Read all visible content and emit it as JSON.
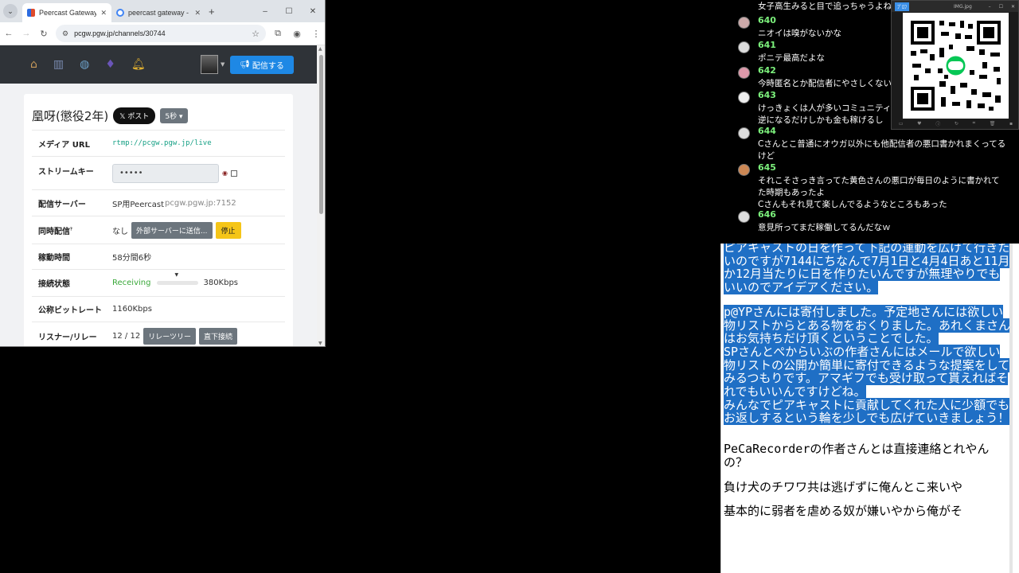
{
  "browser": {
    "tabs": [
      {
        "title": "Peercast Gateway /",
        "active": true
      },
      {
        "title": "peercast gateway -",
        "active": false
      }
    ],
    "new_tab": "+",
    "window_controls": [
      "–",
      "☐",
      "✕"
    ],
    "url": "pcgw.pgw.jp/channels/30744"
  },
  "site": {
    "nav_icons": [
      "home-icon",
      "chart-icon",
      "globe-icon",
      "fire-icon",
      "bell-icon"
    ],
    "broadcast_button": "配信する"
  },
  "channel": {
    "title": "凰呀(懲役2年)",
    "post_button": "ポスト",
    "interval_select": "5秒",
    "rows": {
      "media_url": {
        "label": "メディア URL",
        "value": "rtmp://pcgw.pgw.jp/live"
      },
      "stream_key": {
        "label": "ストリームキー",
        "value": "•••••"
      },
      "server": {
        "label": "配信サーバー",
        "value": "SP用Peercast",
        "host": "pcgw.pgw.jp:7152"
      },
      "simulcast": {
        "label": "同時配信",
        "sup": "?",
        "value": "なし",
        "send_button": "外部サーバーに送信...",
        "stop_button": "停止"
      },
      "uptime": {
        "label": "稼動時間",
        "value": "58分間6秒"
      },
      "connection": {
        "label": "接続状態",
        "status": "Receiving",
        "bitrate": "380Kbps",
        "level": 0.2
      },
      "nominal_bitrate": {
        "label": "公称ビットレート",
        "value": "1160Kbps"
      },
      "listeners": {
        "label": "リスナー/リレー",
        "value": "12 / 12",
        "relay_tree_button": "リレーツリー",
        "direct_button": "直下接続"
      }
    }
  },
  "comments": {
    "top_text": "女子高生みると目で追っちゃうよね",
    "items": [
      {
        "num": "640",
        "text": "ニオイは嗅がないかな"
      },
      {
        "num": "641",
        "text": "ポニテ最高だよな"
      },
      {
        "num": "642",
        "text": "今時匿名とか配信者にやさしくないよな"
      },
      {
        "num": "643",
        "text": "けっきょくは人が多いコミュニティだと\n逆になるだけしかも金も稼げるし"
      },
      {
        "num": "644",
        "text": "Cさんとこ普通にオウガ以外にも他配信者の悪口書かれまくってる\nけど"
      },
      {
        "num": "645",
        "text": "それこそさっき言ってた黄色さんの悪口が毎日のように書かれて\nた時期もあったよ\nCさんもそれ見て楽しんでるようなところもあった"
      },
      {
        "num": "646",
        "text": "意見所ってまだ稼働してるんだなｗ"
      }
    ]
  },
  "qr_window": {
    "tag": "ﾌﾟﾛﾌ",
    "title": "IMG.jpg"
  },
  "notes": {
    "paragraphs": [
      {
        "highlight": true,
        "text": "ピアキャストの日を作って下記の運動を広げて行きたいのですが7144にちなんで7月1日と4月4日あと11月か12月当たりに日を作りたいんですが無理やりでもいいのでアイデアください。"
      },
      {
        "highlight": true,
        "text": "p@YPさんには寄付しました。予定地さんには欲しい物リストからとある物をおくりました。あれくまさんはお気持ちだけ頂くということでした。"
      },
      {
        "highlight": true,
        "text": "SPさんとぺからいぶの作者さんにはメールで欲しい物リストの公開か簡単に寄付できるような提案をしてみるつもりです。アマギフでも受け取って貰えればそれでもいいんですけどね。"
      },
      {
        "highlight": true,
        "text": "みんなでピアキャストに貢献してくれた人に少額でもお返しするという輪を少しでも広げていきましょう！"
      },
      {
        "highlight": false,
        "text": "PeCaRecorderの作者さんとは直接連絡とれやんの？"
      },
      {
        "highlight": false,
        "text": "負け犬のチワワ共は逃げずに俺んとこ来いや"
      },
      {
        "highlight": false,
        "text": "基本的に弱者を虐める奴が嫌いやから俺がそ"
      }
    ]
  }
}
